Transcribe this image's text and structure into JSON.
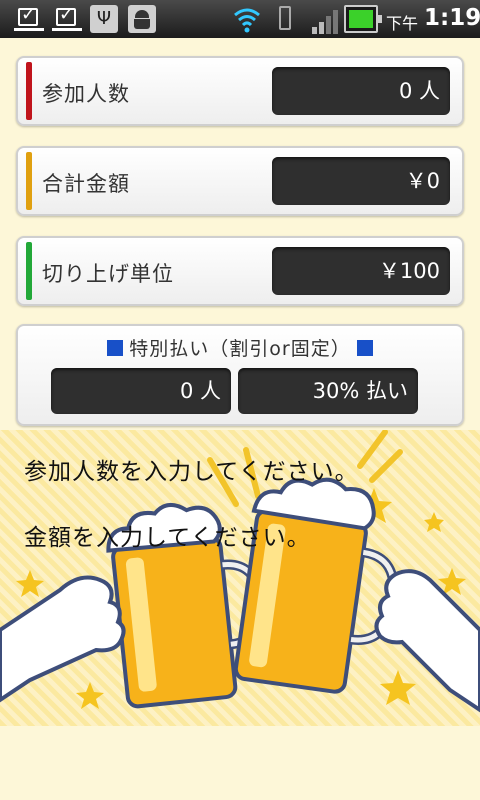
{
  "status_bar": {
    "icons": [
      "check-notification-icon",
      "check-notification-icon",
      "usb-icon",
      "debug-icon",
      "wifi-icon",
      "vibrate-icon",
      "signal-icon",
      "battery-icon"
    ],
    "ampm": "下午",
    "time": "1:19"
  },
  "colors": {
    "participants_accent": "#c0141c",
    "amount_accent": "#e0a010",
    "rounding_accent": "#22a838",
    "special_marker": "#1850c8"
  },
  "participants": {
    "label": "参加人数",
    "value": "0 人"
  },
  "amount": {
    "label": "合計金額",
    "value": "￥0"
  },
  "rounding": {
    "label": "切り上げ単位",
    "value": "￥100"
  },
  "special": {
    "title": "特別払い（割引or固定）",
    "count_value": "0 人",
    "rate_value": "30% 払い"
  },
  "messages": {
    "line1": "参加人数を入力してください。",
    "line2": "金額を入力してください。"
  },
  "illustration": {
    "icon": "beer-toast-illustration"
  }
}
